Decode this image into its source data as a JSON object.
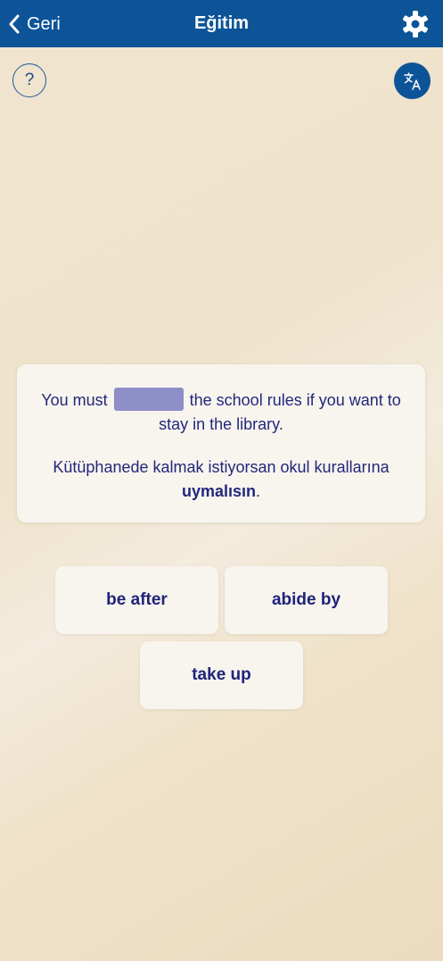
{
  "header": {
    "back_label": "Geri",
    "title": "Eğitim",
    "back_icon": "chevron-left-icon",
    "settings_icon": "gear-icon"
  },
  "toolbar": {
    "help_label": "?",
    "translate_icon": "translate-icon"
  },
  "question": {
    "sentence_before": "You must",
    "sentence_after": "the school rules if you want to stay in the library.",
    "translation_before": "Kütüphanede kalmak istiyorsan okul kurallarına",
    "translation_highlight": "uymalısın",
    "translation_after": "."
  },
  "options": [
    {
      "label": "be after"
    },
    {
      "label": "abide by"
    },
    {
      "label": "take up"
    }
  ],
  "colors": {
    "header_bg": "#0c5497",
    "text_primary": "#22287a",
    "blank_fill": "#8e8ec8",
    "card_bg": "#f8f4ee"
  }
}
